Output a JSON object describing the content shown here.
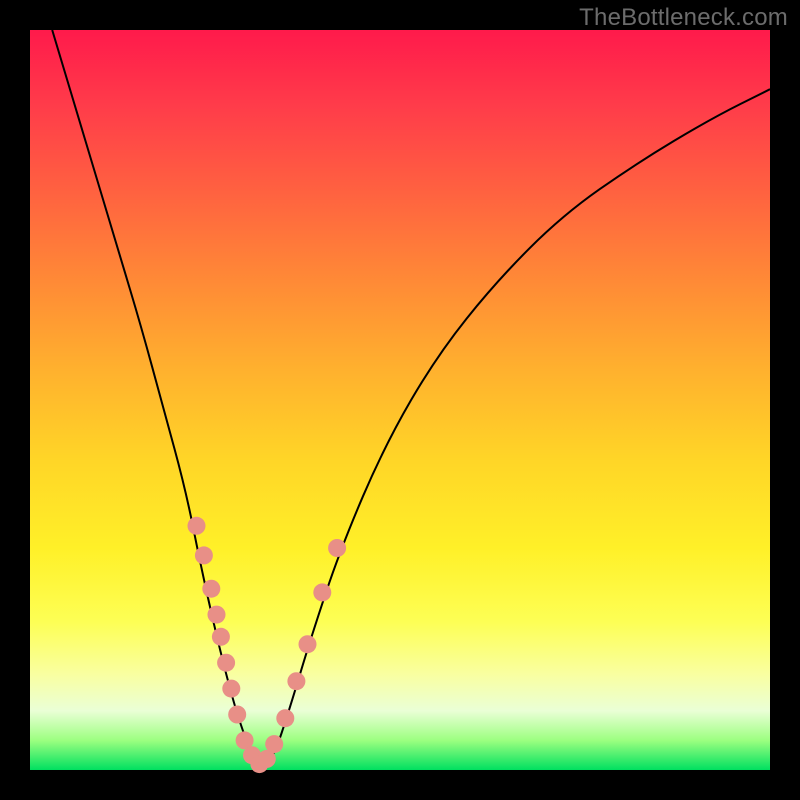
{
  "watermark": "TheBottleneck.com",
  "chart_data": {
    "type": "line",
    "title": "",
    "xlabel": "",
    "ylabel": "",
    "xlim": [
      0,
      100
    ],
    "ylim": [
      0,
      100
    ],
    "grid": false,
    "legend": false,
    "background": "rainbow-vertical",
    "series": [
      {
        "name": "bottleneck-curve",
        "x": [
          3,
          6,
          9,
          12,
          15,
          18,
          21,
          23,
          25,
          27,
          28.5,
          30,
          31.5,
          33,
          35,
          38,
          42,
          48,
          55,
          63,
          72,
          82,
          92,
          100
        ],
        "y": [
          100,
          90,
          80,
          70,
          60,
          49,
          38,
          28,
          19,
          11,
          6,
          2,
          0.5,
          2,
          8,
          18,
          30,
          44,
          56,
          66,
          75,
          82,
          88,
          92
        ]
      }
    ],
    "points": {
      "name": "sample-points",
      "x": [
        22.5,
        23.5,
        24.5,
        25.2,
        25.8,
        26.5,
        27.2,
        28.0,
        29.0,
        30.0,
        31.0,
        32.0,
        33.0,
        34.5,
        36.0,
        37.5,
        39.5,
        41.5
      ],
      "y": [
        33.0,
        29.0,
        24.5,
        21.0,
        18.0,
        14.5,
        11.0,
        7.5,
        4.0,
        2.0,
        0.8,
        1.5,
        3.5,
        7.0,
        12.0,
        17.0,
        24.0,
        30.0
      ]
    }
  }
}
